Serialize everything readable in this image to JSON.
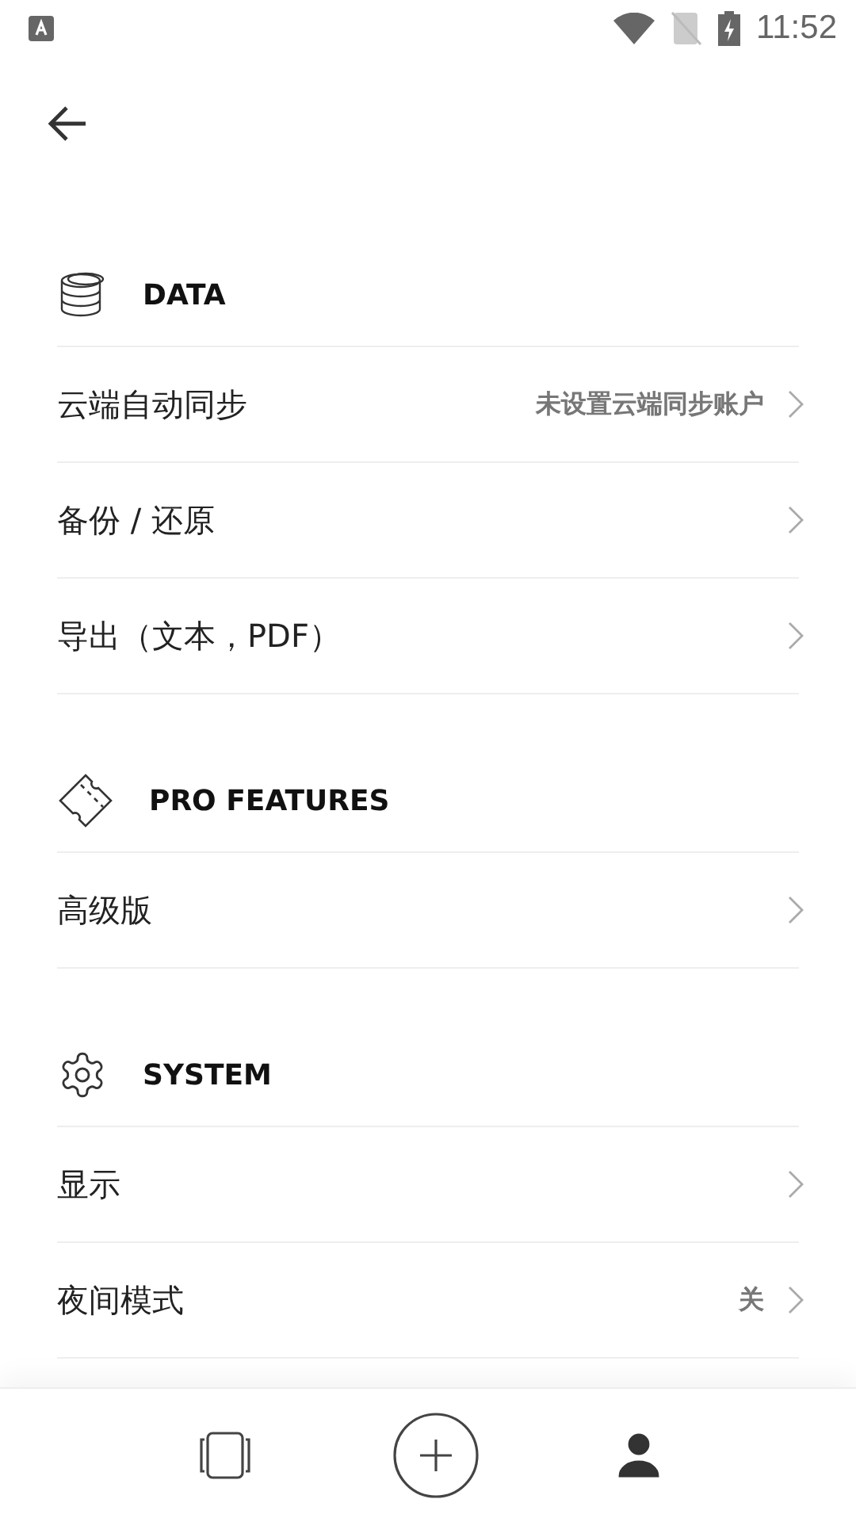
{
  "status_bar": {
    "time": "11:52"
  },
  "sections": [
    {
      "title": "DATA",
      "kind": "database",
      "rows": [
        {
          "label": "云端自动同步",
          "value": "未设置云端同步账户"
        },
        {
          "label": "备份 / 还原"
        },
        {
          "label": "导出（文本，PDF）"
        }
      ]
    },
    {
      "title": "PRO FEATURES",
      "kind": "ticket",
      "rows": [
        {
          "label": "高级版"
        }
      ]
    },
    {
      "title": "SYSTEM",
      "kind": "gear",
      "rows": [
        {
          "label": "显示"
        },
        {
          "label": "夜间模式",
          "value": "关"
        }
      ]
    }
  ],
  "bottom_nav": [
    {
      "kind": "cards",
      "selected": false
    },
    {
      "kind": "add",
      "selected": false
    },
    {
      "kind": "person",
      "selected": true
    }
  ]
}
